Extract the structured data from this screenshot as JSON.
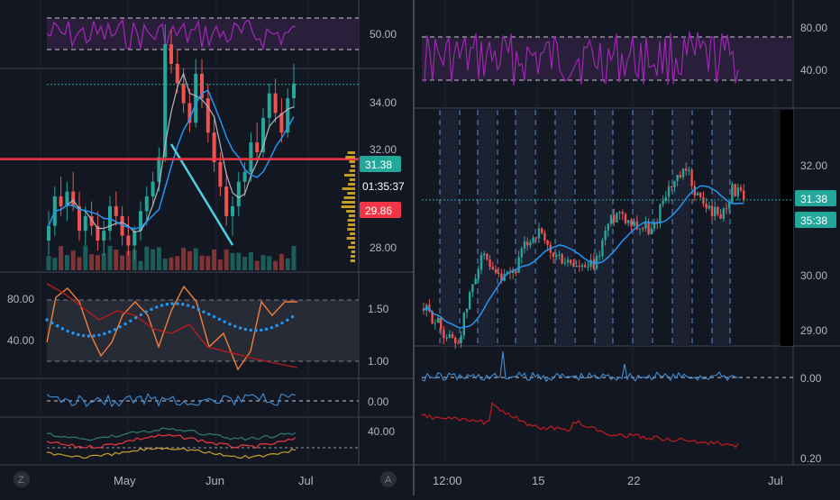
{
  "colors": {
    "background": "#131722",
    "grid": "#1f2330",
    "axis_text": "#b2b5be",
    "divider": "#434651",
    "candle_up": "#26a69a",
    "candle_down": "#ef5350",
    "rsi_line": "#9c27b0",
    "ma_blue": "#2196f3",
    "ma_gray": "#b2b5be",
    "trend_line": "#4dd0e1",
    "support_red": "#f23645",
    "price_tag_teal": "#22a79a",
    "stoch_orange": "#f57c3c",
    "stoch_dark_red": "#b71c1c",
    "stoch_dots": "#2196f3",
    "panel_fill": "#2a2e39",
    "yellow_line": "#c9a227"
  },
  "left_chart": {
    "x_ticks": [
      "May",
      "Jun",
      "Jul"
    ],
    "rsi_axis": [
      "50.00"
    ],
    "price_axis": [
      "34.00",
      "32.00",
      "28.00"
    ],
    "last_price_tag": "31.38",
    "countdown_tag": "01:35:37",
    "support_tag": "29.86",
    "stoch_left_axis": [
      "80.00",
      "40.00"
    ],
    "stoch_right_axis": [
      "1.50",
      "1.00"
    ],
    "momentum_axis": [
      "0.00"
    ],
    "bottom_axis": [
      "40.00"
    ],
    "corner_badge": "Z"
  },
  "right_chart": {
    "x_ticks": [
      "12:00",
      "15",
      "22",
      "Jul"
    ],
    "rsi_axis": [
      "80.00",
      "40.00"
    ],
    "price_axis": [
      "32.00",
      "30.00",
      "29.00"
    ],
    "last_price_tag": "31.38",
    "countdown_tag": "35:38",
    "momentum_axis": [
      "0.00"
    ],
    "bottom_axis": [
      "0.20"
    ],
    "corner_badge": "A"
  },
  "chart_data": [
    {
      "type": "candlestick",
      "title": "",
      "xlabel": "",
      "ylabel": "",
      "x_range": [
        "Apr",
        "Jul"
      ],
      "ylim": [
        27.2,
        34.8
      ],
      "last_price": 31.38,
      "support_level": 29.86,
      "series": [
        {
          "ohlc": [
            [
              28.2,
              28.8,
              27.9,
              28.5
            ],
            [
              28.5,
              29.3,
              28.3,
              29.1
            ],
            [
              29.1,
              29.5,
              28.7,
              28.9
            ],
            [
              28.9,
              29.4,
              28.6,
              29.2
            ],
            [
              29.2,
              29.6,
              28.8,
              28.9
            ],
            [
              28.9,
              29.2,
              28.2,
              28.4
            ],
            [
              28.4,
              28.9,
              28.1,
              28.7
            ],
            [
              28.7,
              29.0,
              28.3,
              28.5
            ],
            [
              28.5,
              28.8,
              28.0,
              28.2
            ],
            [
              28.2,
              28.6,
              27.9,
              28.4
            ],
            [
              28.4,
              29.1,
              28.2,
              28.9
            ],
            [
              28.9,
              29.2,
              28.5,
              28.7
            ],
            [
              28.7,
              28.9,
              28.1,
              28.3
            ],
            [
              28.3,
              28.7,
              27.9,
              28.1
            ],
            [
              28.1,
              28.5,
              27.8,
              28.4
            ],
            [
              28.4,
              29.0,
              28.2,
              28.8
            ],
            [
              28.8,
              29.3,
              28.5,
              29.1
            ],
            [
              29.1,
              29.6,
              28.9,
              29.4
            ],
            [
              29.4,
              30.1,
              29.2,
              29.9
            ],
            [
              29.9,
              32.6,
              29.8,
              32.2
            ],
            [
              32.2,
              32.5,
              31.6,
              31.8
            ],
            [
              31.8,
              32.1,
              31.2,
              31.4
            ],
            [
              31.4,
              31.7,
              30.8,
              31.0
            ],
            [
              31.0,
              31.3,
              30.4,
              30.6
            ],
            [
              30.6,
              31.9,
              30.5,
              31.6
            ],
            [
              31.6,
              31.9,
              30.9,
              31.1
            ],
            [
              31.1,
              31.4,
              30.2,
              30.4
            ],
            [
              30.4,
              30.7,
              29.6,
              29.8
            ],
            [
              29.8,
              30.0,
              29.1,
              29.3
            ],
            [
              29.3,
              29.6,
              28.5,
              28.7
            ],
            [
              28.7,
              29.1,
              28.3,
              28.9
            ],
            [
              28.9,
              29.6,
              28.7,
              29.4
            ],
            [
              29.4,
              29.8,
              29.1,
              29.6
            ],
            [
              29.6,
              30.4,
              29.4,
              30.2
            ],
            [
              30.2,
              30.6,
              29.8,
              30.0
            ],
            [
              30.0,
              30.9,
              29.9,
              30.7
            ],
            [
              30.7,
              31.4,
              30.5,
              31.2
            ],
            [
              31.2,
              31.5,
              30.6,
              30.8
            ],
            [
              30.8,
              31.1,
              30.2,
              30.4
            ],
            [
              30.4,
              31.3,
              30.3,
              31.1
            ],
            [
              31.1,
              31.8,
              30.9,
              31.4
            ]
          ]
        }
      ]
    },
    {
      "type": "candlestick",
      "title": "",
      "xlabel": "",
      "ylabel": "",
      "x_range": [
        "12:00",
        "Jul"
      ],
      "ylim": [
        28.7,
        33.0
      ],
      "last_price": 31.38
    }
  ]
}
